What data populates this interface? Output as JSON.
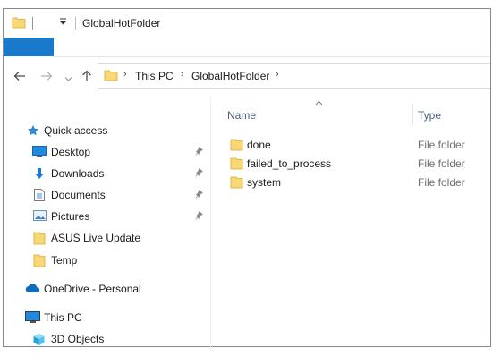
{
  "title_bar": {
    "window_title": "GlobalHotFolder",
    "quick_access_toolbar_icon": "chevron-down-icon"
  },
  "ribbon": {
    "file_tab_color": "#1979ca"
  },
  "navigation": {
    "back_icon": "arrow-left-icon",
    "forward_icon": "arrow-right-icon",
    "recent_icon": "chevron-down-icon",
    "up_icon": "arrow-up-icon"
  },
  "address_bar": {
    "breadcrumbs": [
      "This PC",
      "GlobalHotFolder"
    ]
  },
  "nav_pane": {
    "items": [
      {
        "label": "Quick access",
        "icon": "star-icon"
      },
      {
        "label": "Desktop",
        "icon": "desktop-icon",
        "pinned": true
      },
      {
        "label": "Downloads",
        "icon": "download-icon",
        "pinned": true
      },
      {
        "label": "Documents",
        "icon": "documents-icon",
        "pinned": true
      },
      {
        "label": "Pictures",
        "icon": "pictures-icon",
        "pinned": true
      },
      {
        "label": "ASUS Live Update",
        "icon": "folder-icon"
      },
      {
        "label": "Temp",
        "icon": "folder-icon"
      },
      {
        "label": "OneDrive - Personal",
        "icon": "cloud-icon"
      },
      {
        "label": "This PC",
        "icon": "computer-icon"
      },
      {
        "label": "3D Objects",
        "icon": "cube-icon"
      }
    ]
  },
  "file_list": {
    "columns": [
      "Name",
      "Type"
    ],
    "sort_indicator_icon": "caret-up-icon",
    "rows": [
      {
        "name": "done",
        "type": "File folder"
      },
      {
        "name": "failed_to_process",
        "type": "File folder"
      },
      {
        "name": "system",
        "type": "File folder"
      }
    ]
  }
}
